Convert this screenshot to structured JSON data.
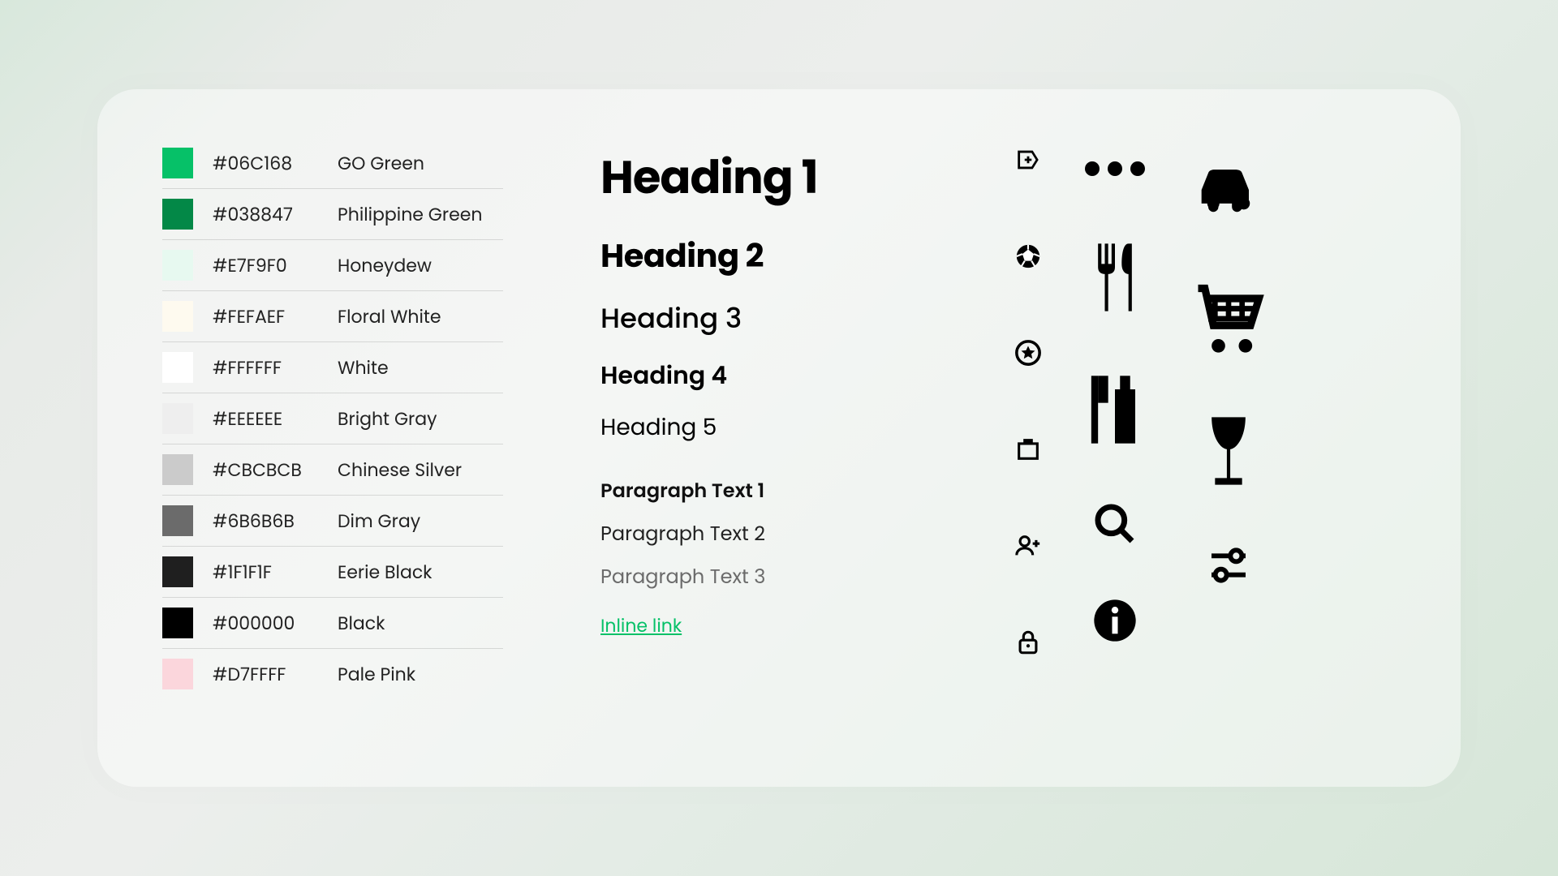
{
  "palette": [
    {
      "hex": "#06C168",
      "name": "GO Green",
      "color": "#06C168"
    },
    {
      "hex": "#038847",
      "name": "Philippine Green",
      "color": "#038847"
    },
    {
      "hex": "#E7F9F0",
      "name": "Honeydew",
      "color": "#E7F9F0"
    },
    {
      "hex": "#FEFAEF",
      "name": "Floral White",
      "color": "#FEFAEF"
    },
    {
      "hex": "#FFFFFF",
      "name": "White",
      "color": "#FFFFFF"
    },
    {
      "hex": "#EEEEEE",
      "name": "Bright Gray",
      "color": "#EEEEEE"
    },
    {
      "hex": "#CBCBCB",
      "name": "Chinese Silver",
      "color": "#CBCBCB"
    },
    {
      "hex": "#6B6B6B",
      "name": "Dim Gray",
      "color": "#6B6B6B"
    },
    {
      "hex": "#1F1F1F",
      "name": "Eerie Black",
      "color": "#1F1F1F"
    },
    {
      "hex": "#000000",
      "name": "Black",
      "color": "#000000"
    },
    {
      "hex": "#D7FFFF",
      "name": "Pale Pink",
      "color": "#FBD6DC"
    }
  ],
  "typography": {
    "h1": "Heading 1",
    "h2": "Heading 2",
    "h3": "Heading 3",
    "h4": "Heading 4",
    "h5": "Heading 5",
    "p1": "Paragraph Text 1",
    "p2": "Paragraph Text 2",
    "p3": "Paragraph Text 3",
    "link": "Inline link"
  },
  "icons": {
    "small": [
      "tag",
      "ball",
      "star-circle",
      "briefcase",
      "add-user",
      "lock"
    ],
    "mid": [
      "more-dots",
      "fork-knife",
      "toothbrush",
      "search",
      "info"
    ],
    "large": [
      "car",
      "cart",
      "wine-glass",
      "settings-sliders"
    ]
  }
}
